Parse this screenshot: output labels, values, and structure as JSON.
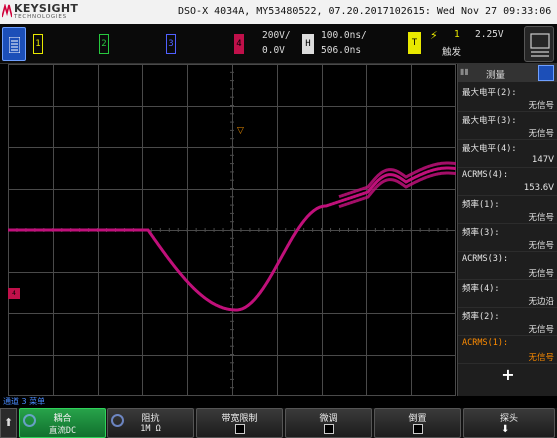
{
  "banner": {
    "brand": "KEYSIGHT",
    "brand_sub": "TECHNOLOGIES",
    "device_info": "DSO-X 4034A, MY53480522, 07.20.2017102615: Wed Nov 27 09:33:06 2019"
  },
  "channels": {
    "ch1": "1",
    "ch2": "2",
    "ch3": "3",
    "ch4": "4",
    "ch4_scale": "200V/",
    "ch4_offset": "0.0V"
  },
  "horizontal": {
    "label": "H",
    "time_scale": "100.0ns/",
    "delay": "506.0ns"
  },
  "trigger": {
    "label": "T",
    "edge_symbol": "⚡",
    "source": "1",
    "level": "2.25V",
    "mode": "触发"
  },
  "scope": {
    "ch4_marker": "4",
    "trigger_marker": "▽",
    "trace_color": "#c0107a",
    "grid_color": "#4a4a4a"
  },
  "panel": {
    "title": "测量",
    "measurements": [
      {
        "label": "最大电平(2):",
        "value": "无信号"
      },
      {
        "label": "最大电平(3):",
        "value": "无信号"
      },
      {
        "label": "最大电平(4):",
        "value": "147V"
      },
      {
        "label": "ACRMS(4):",
        "value": "153.6V"
      },
      {
        "label": "频率(1):",
        "value": "无信号"
      },
      {
        "label": "频率(3):",
        "value": "无信号"
      },
      {
        "label": "ACRMS(3):",
        "value": "无信号"
      },
      {
        "label": "频率(4):",
        "value": "无边沿"
      },
      {
        "label": "频率(2):",
        "value": "无信号"
      },
      {
        "label": "ACRMS(1):",
        "value": "无信号"
      }
    ],
    "add_label": "+"
  },
  "status_line": "通道 3 菜单",
  "softkeys": {
    "coupling_title": "耦合",
    "coupling_value": "直流DC",
    "impedance_title": "阻抗",
    "impedance_value": "1M Ω",
    "bw_limit_title": "带宽限制",
    "fine_title": "微调",
    "invert_title": "倒置",
    "probe_title": "探头"
  }
}
